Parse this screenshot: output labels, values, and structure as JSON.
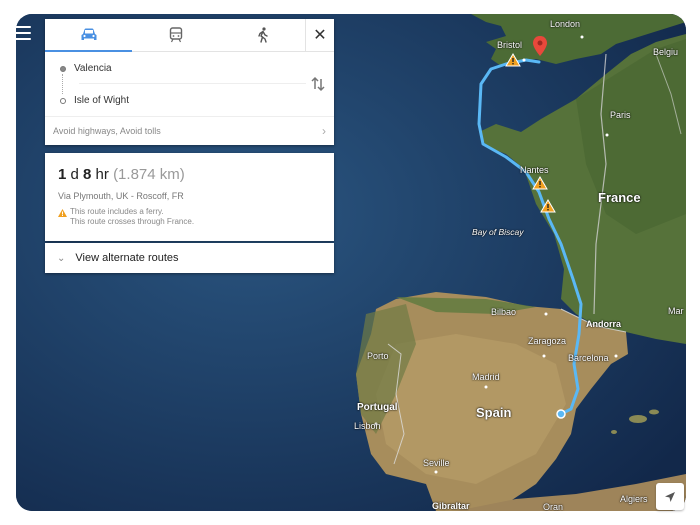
{
  "directions": {
    "modes": [
      {
        "name": "car-icon",
        "active": true
      },
      {
        "name": "transit-icon",
        "active": false
      },
      {
        "name": "walk-icon",
        "active": false
      }
    ],
    "close_label": "✕",
    "origin": "Valencia",
    "destination": "Isle of Wight",
    "options": "Avoid highways, Avoid tolls"
  },
  "route": {
    "days": "1",
    "days_unit": "d",
    "hours": "8",
    "hours_unit": "hr",
    "distance": "(1.874 km)",
    "via": "Via Plymouth, UK - Roscoff, FR",
    "warning_ferry": "This route includes a ferry.",
    "warning_border": "This route crosses through France."
  },
  "alt_routes": {
    "label": "View alternate routes"
  },
  "map": {
    "places": {
      "london": "London",
      "bristol": "Bristol",
      "belgium": "Belgiu",
      "nantes": "Nantes",
      "paris": "Paris",
      "france": "France",
      "bay_of_biscay": "Bay of Biscay",
      "bilbao": "Bilbao",
      "andorra": "Andorra",
      "zaragoza": "Zaragoza",
      "barcelona": "Barcelona",
      "porto": "Porto",
      "portugal": "Portugal",
      "madrid": "Madrid",
      "spain": "Spain",
      "lisbon": "Lisbon",
      "seville": "Seville",
      "gibraltar": "Gibraltar",
      "algiers": "Algiers",
      "oran": "Oran",
      "mar": "Mar"
    },
    "colors": {
      "route": "#5ab8f5",
      "destination_pin": "#e8483b",
      "warning": "#f0a020",
      "sea": "#1e3d62",
      "active_tab": "#4a90e2"
    }
  }
}
